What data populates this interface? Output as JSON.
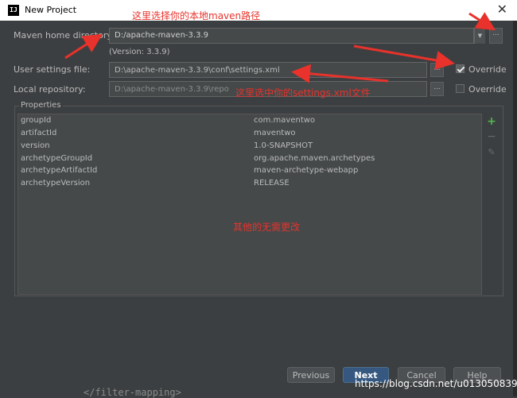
{
  "window": {
    "title": "New Project",
    "logo_text": "IJ",
    "close_glyph": "✕"
  },
  "maven": {
    "home_label": "Maven home directory:",
    "home_value": "D:/apache-maven-3.3.9",
    "version_text": "(Version: 3.3.9)",
    "settings_label": "User settings file:",
    "settings_value": "D:\\apache-maven-3.3.9\\conf\\settings.xml",
    "settings_override_label": "Override",
    "settings_override_checked": true,
    "repo_label": "Local repository:",
    "repo_value": "D:\\apache-maven-3.3.9\\repo",
    "repo_override_label": "Override",
    "repo_override_checked": false,
    "browse_glyph": "...",
    "dropdown_glyph": "▼"
  },
  "properties": {
    "group_title": "Properties",
    "rows": [
      {
        "key": "groupId",
        "value": "com.maventwo"
      },
      {
        "key": "artifactId",
        "value": "maventwo"
      },
      {
        "key": "version",
        "value": "1.0-SNAPSHOT"
      },
      {
        "key": "archetypeGroupId",
        "value": "org.apache.maven.archetypes"
      },
      {
        "key": "archetypeArtifactId",
        "value": "maven-archetype-webapp"
      },
      {
        "key": "archetypeVersion",
        "value": "RELEASE"
      }
    ],
    "tools": {
      "add_glyph": "+",
      "remove_glyph": "−",
      "edit_glyph": "✎"
    }
  },
  "buttons": {
    "previous": "Previous",
    "next": "Next",
    "cancel": "Cancel",
    "help": "Help"
  },
  "annotations": {
    "top": "这里选择你的本地maven路径",
    "middle": "这里选中你的settings.xml文件",
    "bottom": "其他的无需更改"
  },
  "watermark": "https://blog.csdn.net/u013050839",
  "background_peek": "</filter-mapping>",
  "colors": {
    "accent": "#365880",
    "annotation": "#e8322b",
    "dialog_bg": "#3c3f41"
  }
}
